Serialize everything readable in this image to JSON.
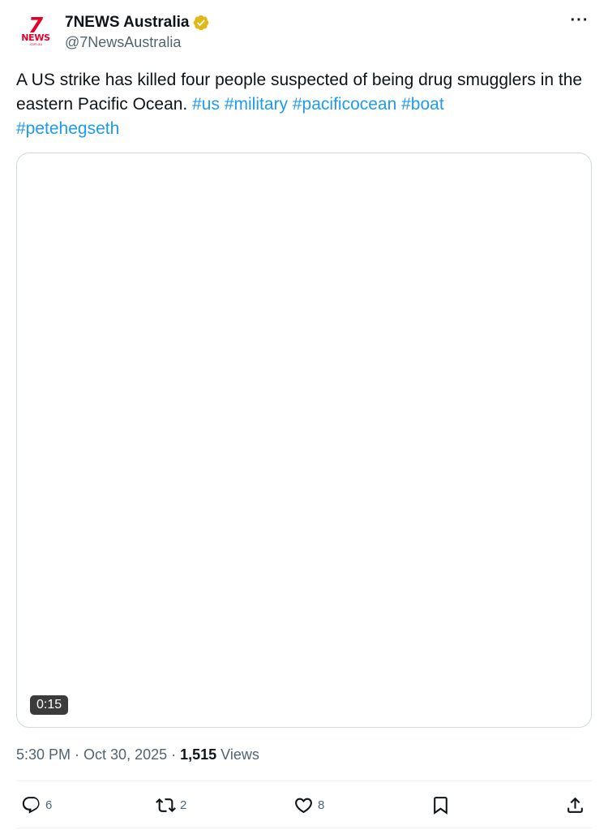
{
  "author": {
    "display_name": "7NEWS Australia",
    "handle": "@7NewsAustralia",
    "avatar_icon": "7news-logo",
    "avatar_lines": [
      "7",
      "NEWS",
      ".com.au"
    ],
    "verified_icon": "verified-gold-badge-icon"
  },
  "tweet": {
    "text": "A US strike has killed four people suspected of being drug smugglers in the eastern Pacific Ocean.",
    "hashtags": [
      "#us",
      "#military",
      "#pacificocean",
      "#boat",
      "#petehegseth"
    ]
  },
  "media": {
    "duration": "0:15"
  },
  "meta": {
    "time": "5:30 PM",
    "date": "Oct 30, 2025",
    "views_count": "1,515",
    "views_label": "Views"
  },
  "actions": {
    "replies": "6",
    "reposts": "2",
    "likes": "8"
  },
  "colors": {
    "link": "#1d9bf0",
    "text": "#0f1419",
    "secondary": "#536471",
    "brand": "#e4002b",
    "verified": "#e2b719"
  }
}
